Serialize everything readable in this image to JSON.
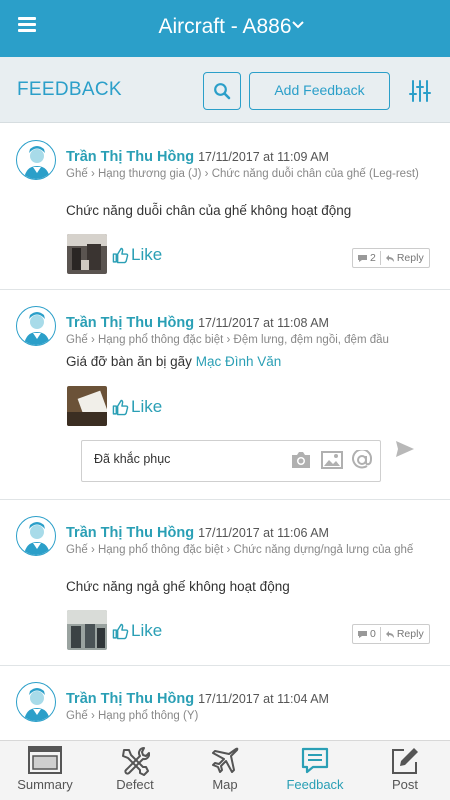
{
  "header": {
    "title": "Aircraft - A886",
    "menu_icon": "hamburger-icon",
    "dropdown_icon": "chevron-down-icon"
  },
  "subheader": {
    "title": "FEEDBACK",
    "search_icon": "search-icon",
    "add_button": "Add Feedback",
    "filter_icon": "sliders-icon"
  },
  "like_label": "Like",
  "reply_label": "Reply",
  "feed": [
    {
      "author": "Trần Thị Thu Hồng",
      "time": "17/11/2017 at 11:09 AM",
      "path_1": "Ghế",
      "path_2": "Hạng thương gia (J)",
      "path_3": "Chức năng duỗi chân của ghế (Leg-rest)",
      "text": "Chức năng duỗi chân của ghế không hoạt động",
      "mention": "",
      "comments": "2"
    },
    {
      "author": "Trần Thị Thu Hồng",
      "time": "17/11/2017 at 11:08 AM",
      "path_1": "Ghế",
      "path_2": "Hạng phổ thông đặc biệt",
      "path_3": "Đệm lưng, đệm ngồi, đệm đầu",
      "text": "Giá đỡ bàn ăn bị gãy",
      "mention": "Mạc Đình Văn",
      "comment_input": "Đã khắc phục"
    },
    {
      "author": "Trần Thị Thu Hồng",
      "time": "17/11/2017 at 11:06 AM",
      "path_1": "Ghế",
      "path_2": "Hạng phổ thông đặc biệt",
      "path_3": "Chức năng dựng/ngả lưng của ghế",
      "text": "Chức năng ngả ghế không hoạt động",
      "mention": "",
      "comments": "0"
    },
    {
      "author": "Trần Thị Thu Hồng",
      "time": "17/11/2017 at 11:04 AM",
      "path_1": "Ghế",
      "path_2": "Hạng phổ thông (Y)",
      "path_3": "",
      "text": "",
      "mention": ""
    }
  ],
  "tabs": [
    {
      "label": "Summary",
      "icon": "summary-icon",
      "active": false
    },
    {
      "label": "Defect",
      "icon": "tools-icon",
      "active": false
    },
    {
      "label": "Map",
      "icon": "airplane-icon",
      "active": false
    },
    {
      "label": "Feedback",
      "icon": "feedback-icon",
      "active": true
    },
    {
      "label": "Post",
      "icon": "edit-icon",
      "active": false
    }
  ],
  "colors": {
    "primary": "#2b9fc9",
    "subheader_bg": "#e8eef1",
    "link": "#2a9fb5"
  }
}
